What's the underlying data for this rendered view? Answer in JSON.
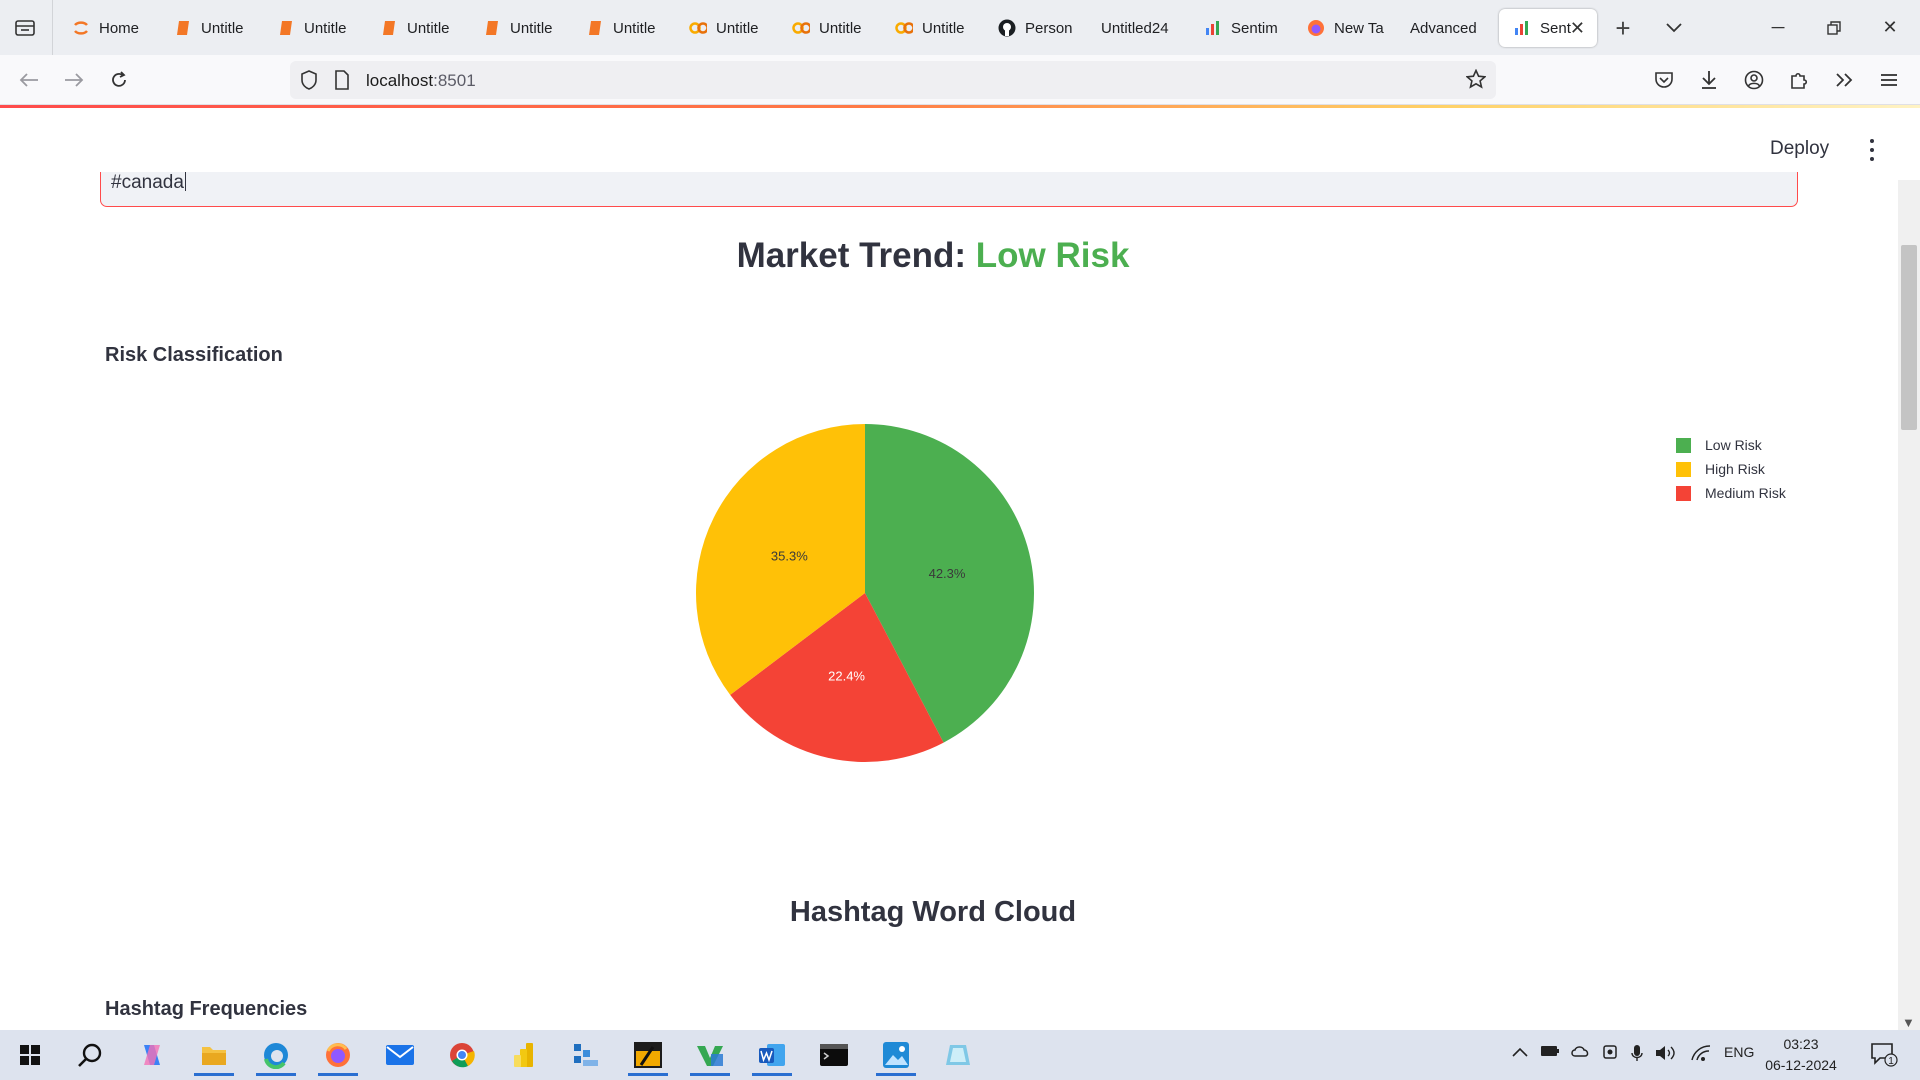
{
  "browser": {
    "tabs": [
      {
        "label": "Home",
        "icon": "jupyter-logo-icon"
      },
      {
        "label": "Untitle",
        "icon": "notebook-icon"
      },
      {
        "label": "Untitle",
        "icon": "notebook-icon"
      },
      {
        "label": "Untitle",
        "icon": "notebook-icon"
      },
      {
        "label": "Untitle",
        "icon": "notebook-icon"
      },
      {
        "label": "Untitle",
        "icon": "notebook-icon"
      },
      {
        "label": "Untitle",
        "icon": "colab-icon"
      },
      {
        "label": "Untitle",
        "icon": "colab-icon"
      },
      {
        "label": "Untitle",
        "icon": "colab-icon"
      },
      {
        "label": "Person",
        "icon": "github-icon"
      },
      {
        "label": "Untitled24",
        "icon": ""
      },
      {
        "label": "Sentim",
        "icon": "chart-favicon-icon"
      },
      {
        "label": "New Ta",
        "icon": "firefox-icon"
      },
      {
        "label": "Advanced",
        "icon": ""
      },
      {
        "label": "Sent",
        "icon": "chart-favicon-icon"
      }
    ],
    "url_host": "localhost",
    "url_port": ":8501"
  },
  "app": {
    "deploy_label": "Deploy",
    "hashtag_input_value": "#canada",
    "trend_prefix": "Market Trend:",
    "trend_value": "Low Risk",
    "risk_heading": "Risk Classification",
    "cloud_title": "Hashtag Word Cloud",
    "freq_heading": "Hashtag Frequencies"
  },
  "chart_data": {
    "type": "pie",
    "title": "",
    "labels": [
      "Low Risk",
      "Medium Risk",
      "High Risk"
    ],
    "values": [
      42.3,
      22.4,
      35.3
    ],
    "colors": [
      "#4caf50",
      "#f44336",
      "#ffc107"
    ],
    "value_labels": [
      "42.3%",
      "22.4%",
      "35.3%"
    ],
    "legend_order": [
      "Low Risk",
      "High Risk",
      "Medium Risk"
    ],
    "legend_placement": "top-right"
  },
  "taskbar": {
    "lang": "ENG",
    "time": "03:23",
    "date": "06-12-2024",
    "notification_count": "1"
  },
  "colors": {
    "accent": "#ff4b4b",
    "low_risk": "#4caf50",
    "text": "#31333f"
  }
}
